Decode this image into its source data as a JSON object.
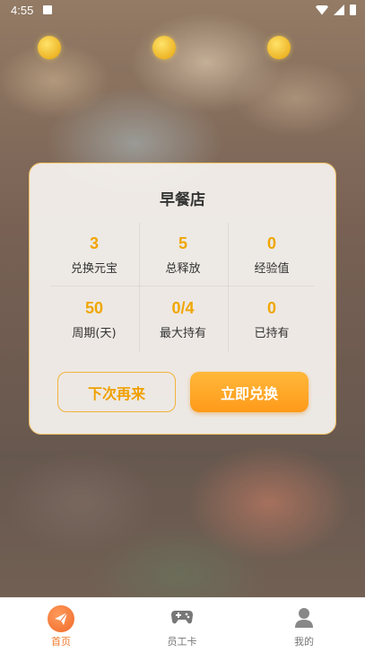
{
  "status_bar": {
    "time": "4:55"
  },
  "dialog": {
    "title": "早餐店",
    "stats": [
      {
        "value": "3",
        "label": "兑换元宝"
      },
      {
        "value": "5",
        "label": "总释放"
      },
      {
        "value": "0",
        "label": "经验值"
      },
      {
        "value": "50",
        "label": "周期(天)"
      },
      {
        "value": "0/4",
        "label": "最大持有"
      },
      {
        "value": "0",
        "label": "已持有"
      }
    ],
    "later_button": "下次再来",
    "exchange_button": "立即兑换"
  },
  "bottom_nav": {
    "items": [
      {
        "label": "首页",
        "icon": "paper-plane-icon",
        "active": true
      },
      {
        "label": "员工卡",
        "icon": "gamepad-icon",
        "active": false
      },
      {
        "label": "我的",
        "icon": "user-icon",
        "active": false
      }
    ]
  },
  "colors": {
    "accent": "#f0a600",
    "button": "#ff9f22",
    "nav_active": "#f07a2a"
  }
}
